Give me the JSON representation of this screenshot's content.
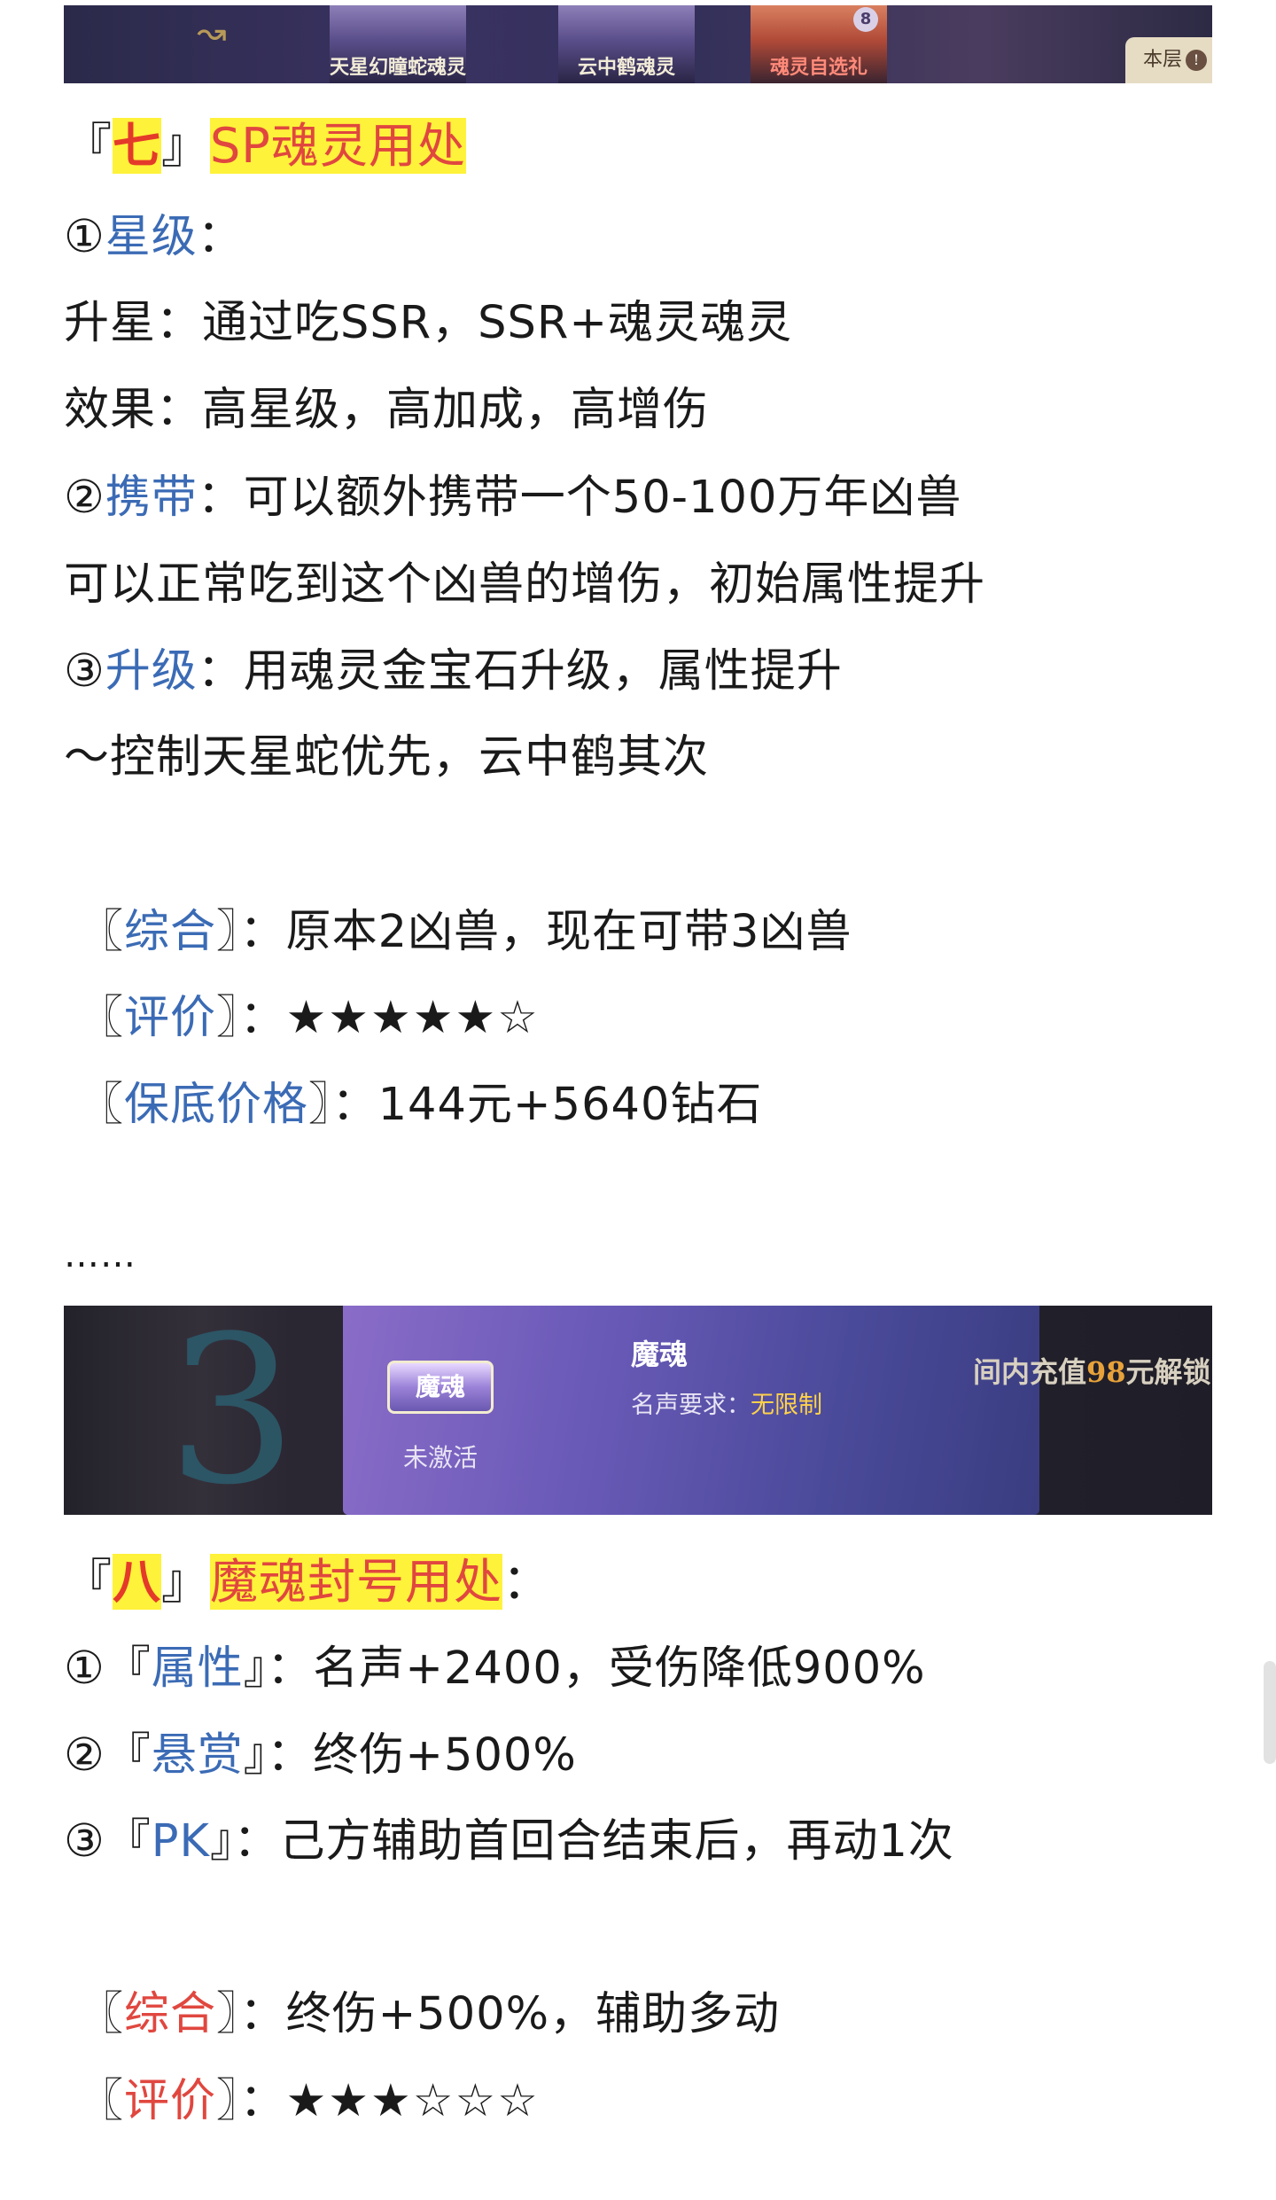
{
  "banner_top": {
    "tiles": [
      "天星幻瞳蛇魂灵",
      "云中鹤魂灵",
      "魂灵自选礼"
    ],
    "badge": "8",
    "floor_label": "本层",
    "floor_icon": "!"
  },
  "section7": {
    "open_quote": "『",
    "number": "七",
    "close_quote": "』",
    "title": "SP魂灵用处",
    "lines": [
      {
        "marker": "①",
        "key": "星级",
        "sep": "：",
        "text": ""
      },
      {
        "marker": "",
        "key": "",
        "sep": "",
        "text": "升星：通过吃SSR，SSR+魂灵魂灵"
      },
      {
        "marker": "",
        "key": "",
        "sep": "",
        "text": "效果：高星级，高加成，高增伤"
      },
      {
        "marker": "②",
        "key": "携带",
        "sep": "：",
        "text": "可以额外携带一个50-100万年凶兽"
      },
      {
        "marker": "",
        "key": "",
        "sep": "",
        "text": "可以正常吃到这个凶兽的增伤，初始属性提升"
      },
      {
        "marker": "③",
        "key": "升级",
        "sep": "：",
        "text": "用魂灵金宝石升级，属性提升"
      },
      {
        "marker": "",
        "key": "",
        "sep": "",
        "text": "～控制天星蛇优先，云中鹤其次"
      }
    ],
    "summary": [
      {
        "open": "〖",
        "key": "综合",
        "close": "〗",
        "sep": "：",
        "text": "原本2凶兽，现在可带3凶兽"
      },
      {
        "open": "〖",
        "key": "评价",
        "close": "〗",
        "sep": "：",
        "text": "★★★★★☆"
      },
      {
        "open": "〖",
        "key": "保底价格",
        "close": "〗",
        "sep": "：",
        "text": "144元+5640钻石"
      }
    ]
  },
  "ellipsis": "……",
  "banner_mid": {
    "badge_label": "魔魂",
    "status": "未激活",
    "name": "魔魂",
    "req_label": "名声要求：",
    "req_value": "无限制",
    "side_prefix": "间内充值",
    "side_num": "98",
    "side_suffix": "元解锁"
  },
  "section8": {
    "open_quote": "『",
    "number": "八",
    "close_quote": "』",
    "title": "魔魂封号用处",
    "title_suffix": "：",
    "lines": [
      {
        "marker": "①",
        "open": "『",
        "key": "属性",
        "close": "』",
        "sep": "：",
        "text": "名声+2400，受伤降低900%"
      },
      {
        "marker": "②",
        "open": "『",
        "key": "悬赏",
        "close": "』",
        "sep": "：",
        "text": "终伤+500%"
      },
      {
        "marker": "③",
        "open": "『",
        "key": "PK",
        "close": "』",
        "sep": "：",
        "text": "己方辅助首回合结束后，再动1次"
      }
    ],
    "summary": [
      {
        "open": "〖",
        "key": "综合",
        "close": "〗",
        "sep": "：",
        "text": "终伤+500%，辅助多动"
      },
      {
        "open": "〖",
        "key": "评价",
        "close": "〗",
        "sep": "：",
        "text": "★★★☆☆☆"
      }
    ]
  },
  "colors": {
    "highlight": "#fff23a",
    "key_blue": "#3b6bb5",
    "key_red": "#e0473f"
  }
}
